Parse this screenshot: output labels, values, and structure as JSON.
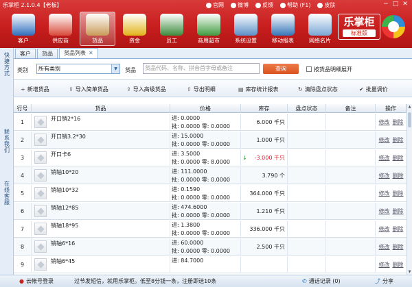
{
  "window": {
    "title": "乐掌柜 2.1.0.4【老板】",
    "controls": [
      "─",
      "□",
      "✕"
    ]
  },
  "sysmenu": [
    {
      "icon": "home-icon",
      "label": "官网"
    },
    {
      "icon": "weibo-icon",
      "label": "微博"
    },
    {
      "icon": "feedback-icon",
      "label": "反馈"
    },
    {
      "icon": "help-icon",
      "label": "帮助 (F1)"
    },
    {
      "icon": "skin-icon",
      "label": "皮肤"
    }
  ],
  "nav": [
    {
      "label": "客户",
      "icon": "customer-icon",
      "color": "#2f6fbd",
      "active": false
    },
    {
      "label": "供应商",
      "icon": "supplier-icon",
      "color": "#d84a3a",
      "active": false
    },
    {
      "label": "货品",
      "icon": "goods-icon",
      "color": "#c99a58",
      "active": true
    },
    {
      "label": "资金",
      "icon": "money-icon",
      "color": "#e2b319",
      "active": false
    },
    {
      "label": "员工",
      "icon": "staff-icon",
      "color": "#3d8b3d",
      "active": false
    },
    {
      "label": "商用超市",
      "icon": "supermarket-icon",
      "color": "#3f9a3f",
      "active": false
    },
    {
      "label": "系统设置",
      "icon": "settings-icon",
      "color": "#5b8fc7",
      "active": false
    },
    {
      "label": "移动报表",
      "icon": "mobile-report-icon",
      "color": "#3675b8",
      "active": false
    },
    {
      "label": "网络名片",
      "icon": "business-card-icon",
      "color": "#7aa6d6",
      "active": false
    }
  ],
  "brand": {
    "name": "乐掌柜",
    "edition": "标准版"
  },
  "rail": [
    "快捷方式",
    "联系我们",
    "在线客服"
  ],
  "tabs": [
    {
      "label": "客户",
      "active": false
    },
    {
      "label": "货品",
      "active": false
    },
    {
      "label": "货品列表",
      "active": true
    }
  ],
  "filter": {
    "category_label": "类别",
    "category_value": "所有类别",
    "goods_label": "货品",
    "goods_placeholder": "货品代码、名称、拼音首字母或备注",
    "query_label": "查询",
    "expand_label": "按货品明细展开"
  },
  "toolbar": [
    {
      "icon": "plus-icon",
      "glyph": "+",
      "label": "新增货品"
    },
    {
      "icon": "import-icon",
      "glyph": "⇪",
      "label": "导入简单货品"
    },
    {
      "icon": "import-advanced-icon",
      "glyph": "⇪",
      "label": "导入高级货品"
    },
    {
      "icon": "export-icon",
      "glyph": "⇧",
      "label": "导出明细"
    },
    {
      "icon": "report-icon",
      "glyph": "▤",
      "label": "库存统计报表"
    },
    {
      "icon": "clear-icon",
      "glyph": "↻",
      "label": "清除盘点状态"
    },
    {
      "icon": "adjust-icon",
      "glyph": "✔",
      "label": "批量调价"
    }
  ],
  "table": {
    "columns": [
      "行号",
      "货品",
      "价格",
      "库存",
      "盘点状态",
      "备注",
      "操作"
    ],
    "op_edit": "修改",
    "op_delete": "删除",
    "rows": [
      {
        "no": "1",
        "name": "开口销2*16",
        "p1": "进: 0.0000",
        "p2": "批: 0.0000    零: 0.0000",
        "stock": "6.000 千只",
        "neg": false,
        "arrow": ""
      },
      {
        "no": "2",
        "name": "开口销3.2*30",
        "p1": "进: 15.0000",
        "p2": "批: 0.0000    零: 0.0000",
        "stock": "1.000 千只",
        "neg": false,
        "arrow": ""
      },
      {
        "no": "3",
        "name": "开口卡6",
        "p1": "进: 3.5000",
        "p2": "批: 0.0000    零: 8.0000",
        "stock": "-3.000 千只",
        "neg": true,
        "arrow": "↓"
      },
      {
        "no": "4",
        "name": "销轴10*20",
        "p1": "进: 111.0000",
        "p2": "批: 0.0000    零: 0.0000",
        "stock": "3.790 个",
        "neg": false,
        "arrow": ""
      },
      {
        "no": "5",
        "name": "销轴10*32",
        "p1": "进: 0.1590",
        "p2": "批: 0.0000    零: 0.0000",
        "stock": "364.000 千只",
        "neg": false,
        "arrow": ""
      },
      {
        "no": "6",
        "name": "销轴12*85",
        "p1": "进: 474.6000",
        "p2": "批: 0.0000    零: 0.0000",
        "stock": "1.210 千只",
        "neg": false,
        "arrow": ""
      },
      {
        "no": "7",
        "name": "销轴18*95",
        "p1": "进: 1.3800",
        "p2": "批: 0.0000    零: 0.0000",
        "stock": "336.000 千只",
        "neg": false,
        "arrow": ""
      },
      {
        "no": "8",
        "name": "销轴6*16",
        "p1": "进: 60.0000",
        "p2": "批: 0.0000    零: 0.0000",
        "stock": "2.500 千只",
        "neg": false,
        "arrow": ""
      },
      {
        "no": "9",
        "name": "销轴6*45",
        "p1": "进: 84.7000",
        "p2": "",
        "stock": "",
        "neg": false,
        "arrow": ""
      }
    ]
  },
  "status": {
    "login": "云帐号登录",
    "message": "过节发短信，就用乐掌柜。低至8分钱一条，注册即送10条",
    "records": "通话记录 (0)",
    "share": "分享"
  }
}
